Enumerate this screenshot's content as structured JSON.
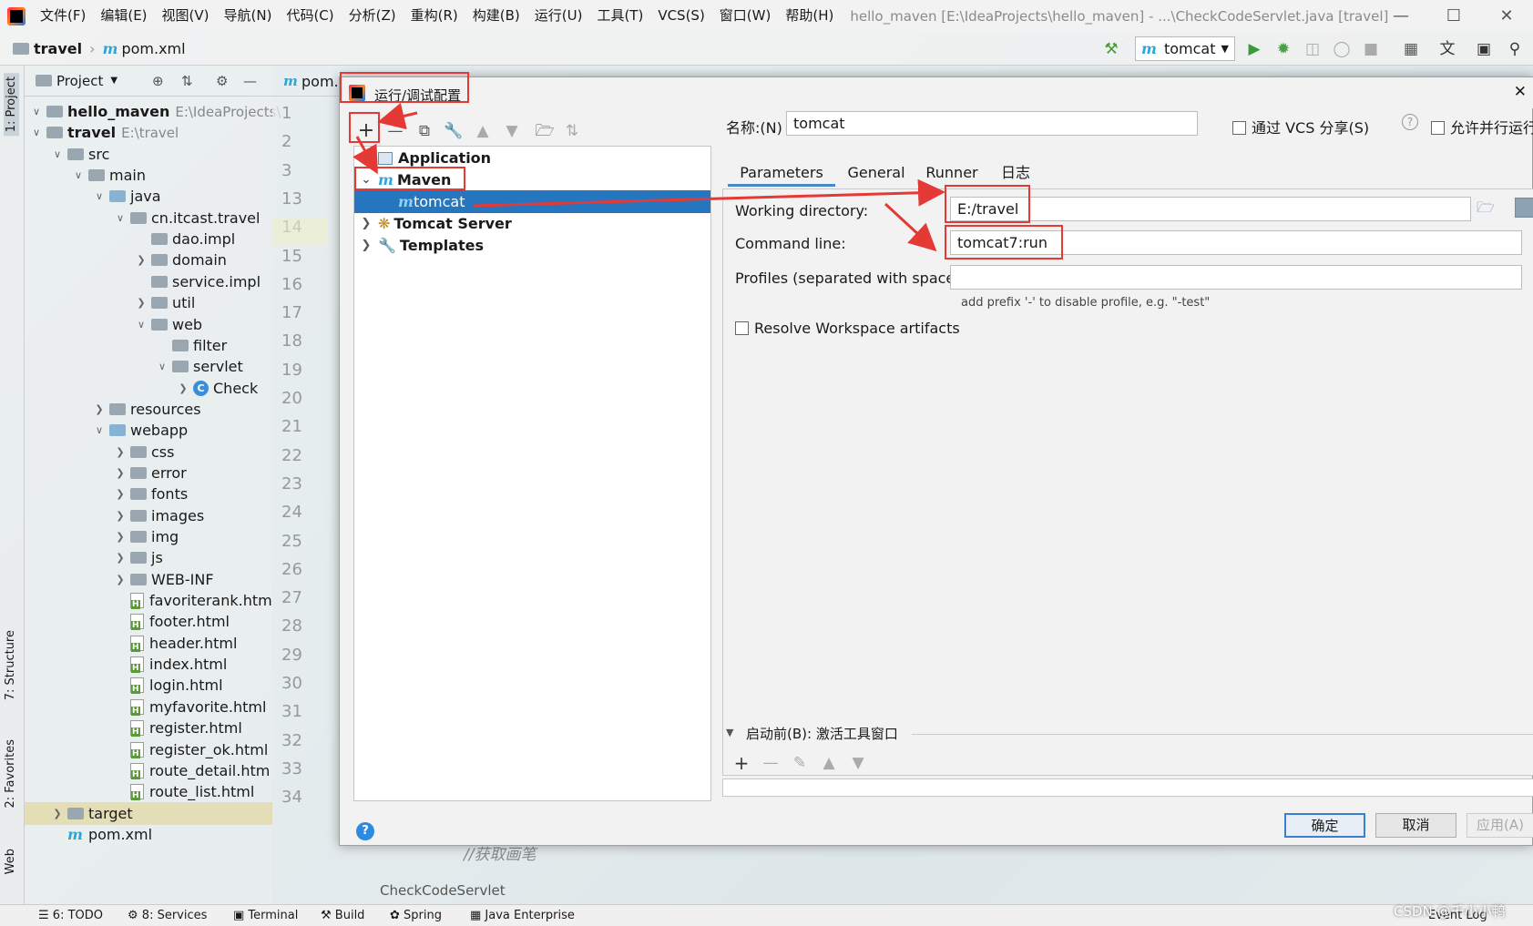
{
  "menu": {
    "items": [
      "文件(F)",
      "编辑(E)",
      "视图(V)",
      "导航(N)",
      "代码(C)",
      "分析(Z)",
      "重构(R)",
      "构建(B)",
      "运行(U)",
      "工具(T)",
      "VCS(S)",
      "窗口(W)",
      "帮助(H)"
    ],
    "window_title": "hello_maven [E:\\IdeaProjects\\hello_maven] - ...\\CheckCodeServlet.java [travel]"
  },
  "nav": {
    "project": "travel",
    "file": "pom.xml",
    "run_config": "tomcat"
  },
  "stripe": {
    "project": "1: Project",
    "structure": "7: Structure",
    "favorites": "2: Favorites",
    "web": "Web"
  },
  "project_panel": {
    "title": "Project",
    "tree": [
      {
        "label": "hello_maven",
        "path": "E:\\IdeaProjects\\"
      },
      {
        "label": "travel",
        "path": "E:\\travel"
      },
      {
        "label": "src"
      },
      {
        "label": "main"
      },
      {
        "label": "java"
      },
      {
        "label": "cn.itcast.travel"
      },
      {
        "label": "dao.impl"
      },
      {
        "label": "domain"
      },
      {
        "label": "service.impl"
      },
      {
        "label": "util"
      },
      {
        "label": "web"
      },
      {
        "label": "filter"
      },
      {
        "label": "servlet"
      },
      {
        "label": "Check"
      },
      {
        "label": "resources"
      },
      {
        "label": "webapp"
      },
      {
        "label": "css"
      },
      {
        "label": "error"
      },
      {
        "label": "fonts"
      },
      {
        "label": "images"
      },
      {
        "label": "img"
      },
      {
        "label": "js"
      },
      {
        "label": "WEB-INF"
      },
      {
        "label": "favoriterank.htm"
      },
      {
        "label": "footer.html"
      },
      {
        "label": "header.html"
      },
      {
        "label": "index.html"
      },
      {
        "label": "login.html"
      },
      {
        "label": "myfavorite.html"
      },
      {
        "label": "register.html"
      },
      {
        "label": "register_ok.html"
      },
      {
        "label": "route_detail.htm"
      },
      {
        "label": "route_list.html"
      },
      {
        "label": "target"
      },
      {
        "label": "pom.xml"
      }
    ]
  },
  "editor": {
    "tab": "pom.",
    "line_numbers": [
      "1",
      "2",
      "3",
      "13",
      "14",
      "15",
      "16",
      "17",
      "18",
      "19",
      "20",
      "21",
      "22",
      "23",
      "24",
      "25",
      "26",
      "27",
      "28",
      "29",
      "30",
      "31",
      "32",
      "33",
      "34"
    ],
    "code_fragment": "//获取画笔",
    "breadcrumb": "CheckCodeServlet"
  },
  "dialog": {
    "title": "运行/调试配置",
    "tree": [
      {
        "label": "Application"
      },
      {
        "label": "Maven"
      },
      {
        "label": "tomcat"
      },
      {
        "label": "Tomcat Server"
      },
      {
        "label": "Templates"
      }
    ],
    "name_label": "名称:(N)",
    "name_value": "tomcat",
    "share_vcs": "通过 VCS 分享(S)",
    "allow_parallel": "允许并行运行",
    "tabs": [
      "Parameters",
      "General",
      "Runner",
      "日志"
    ],
    "working_dir_label": "Working directory:",
    "working_dir": "E:/travel",
    "command_line_label": "Command line:",
    "command_line": "tomcat7:run",
    "profiles_label": "Profiles (separated with space):",
    "profiles_value": "",
    "profiles_hint": "add prefix '-' to disable profile, e.g. \"-test\"",
    "resolve_label": "Resolve Workspace artifacts",
    "before_launch": "启动前(B): 激活工具窗口",
    "ok": "确定",
    "cancel": "取消",
    "apply": "应用(A)"
  },
  "bottom": {
    "items": [
      "6: TODO",
      "8: Services",
      "Terminal",
      "Build",
      "Spring",
      "Java Enterprise",
      "Event Log"
    ],
    "watermark": "CSDN @千小小鸭"
  }
}
